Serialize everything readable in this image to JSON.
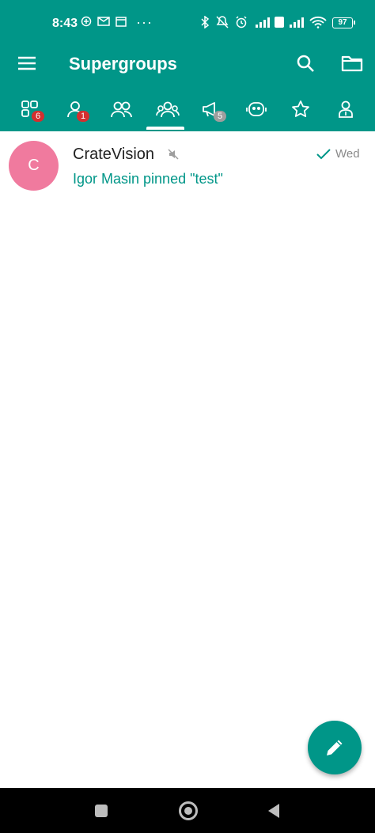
{
  "status_bar": {
    "time": "8:43",
    "battery": "97",
    "more": "···"
  },
  "toolbar": {
    "title": "Supergroups"
  },
  "tabs": [
    {
      "icon": "all-chats-icon",
      "badge": "6",
      "badge_color": "#d32f2f"
    },
    {
      "icon": "private-chats-icon",
      "badge": "1",
      "badge_color": "#d32f2f"
    },
    {
      "icon": "groups-icon",
      "badge": ""
    },
    {
      "icon": "supergroups-icon",
      "badge": "",
      "selected": true
    },
    {
      "icon": "channels-icon",
      "badge": "5",
      "badge_color": "#9e9e9e"
    },
    {
      "icon": "bots-icon",
      "badge": ""
    },
    {
      "icon": "favorites-icon",
      "badge": ""
    },
    {
      "icon": "admin-icon",
      "badge": ""
    }
  ],
  "chats": [
    {
      "avatar_letter": "C",
      "avatar_color": "#f07a9e",
      "name": "CrateVision",
      "muted": true,
      "date": "Wed",
      "message": "Igor Masin pinned \"test\""
    }
  ],
  "colors": {
    "primary": "#009688",
    "accent_text": "#009688"
  }
}
